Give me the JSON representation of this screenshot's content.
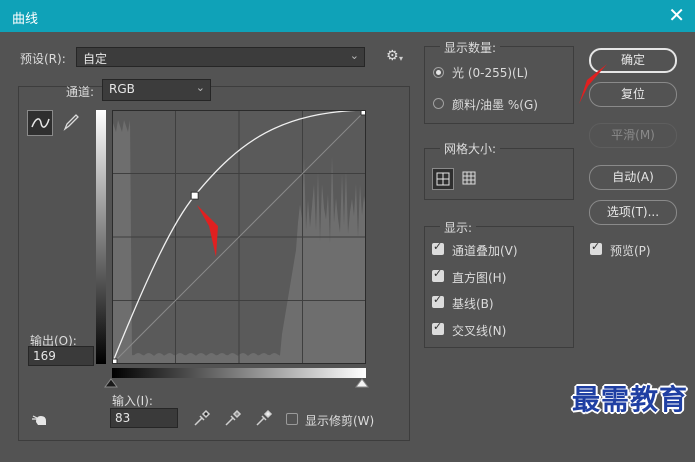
{
  "window": {
    "title": "曲线",
    "close_glyph": "✕"
  },
  "preset": {
    "label": "预设(R):",
    "value": "自定"
  },
  "channel": {
    "label": "通道:",
    "value": "RGB"
  },
  "output": {
    "label": "输出(O):",
    "value": "169"
  },
  "input": {
    "label": "输入(I):",
    "value": "83"
  },
  "show_clipping": {
    "label": "显示修剪(W)",
    "checked": false
  },
  "display_amount": {
    "title": "显示数量:",
    "options": [
      {
        "label": "光 (0-255)(L)",
        "selected": true
      },
      {
        "label": "颜料/油墨 %(G)",
        "selected": false
      }
    ]
  },
  "grid_size": {
    "title": "网格大小:"
  },
  "show": {
    "title": "显示:",
    "options": [
      {
        "label": "通道叠加(V)",
        "checked": true
      },
      {
        "label": "直方图(H)",
        "checked": true
      },
      {
        "label": "基线(B)",
        "checked": true
      },
      {
        "label": "交叉线(N)",
        "checked": true
      }
    ]
  },
  "buttons": {
    "ok": "确定",
    "reset": "复位",
    "smooth": "平滑(M)",
    "auto": "自动(A)",
    "options": "选项(T)..."
  },
  "preview": {
    "label": "预览(P)",
    "checked": true
  },
  "curve_point": {
    "input": 83,
    "output": 169
  },
  "watermark": "最需教育",
  "colors": {
    "titlebar": "#0fa2b8",
    "annotation_arrow": "#e02020",
    "panel": "#535353"
  }
}
